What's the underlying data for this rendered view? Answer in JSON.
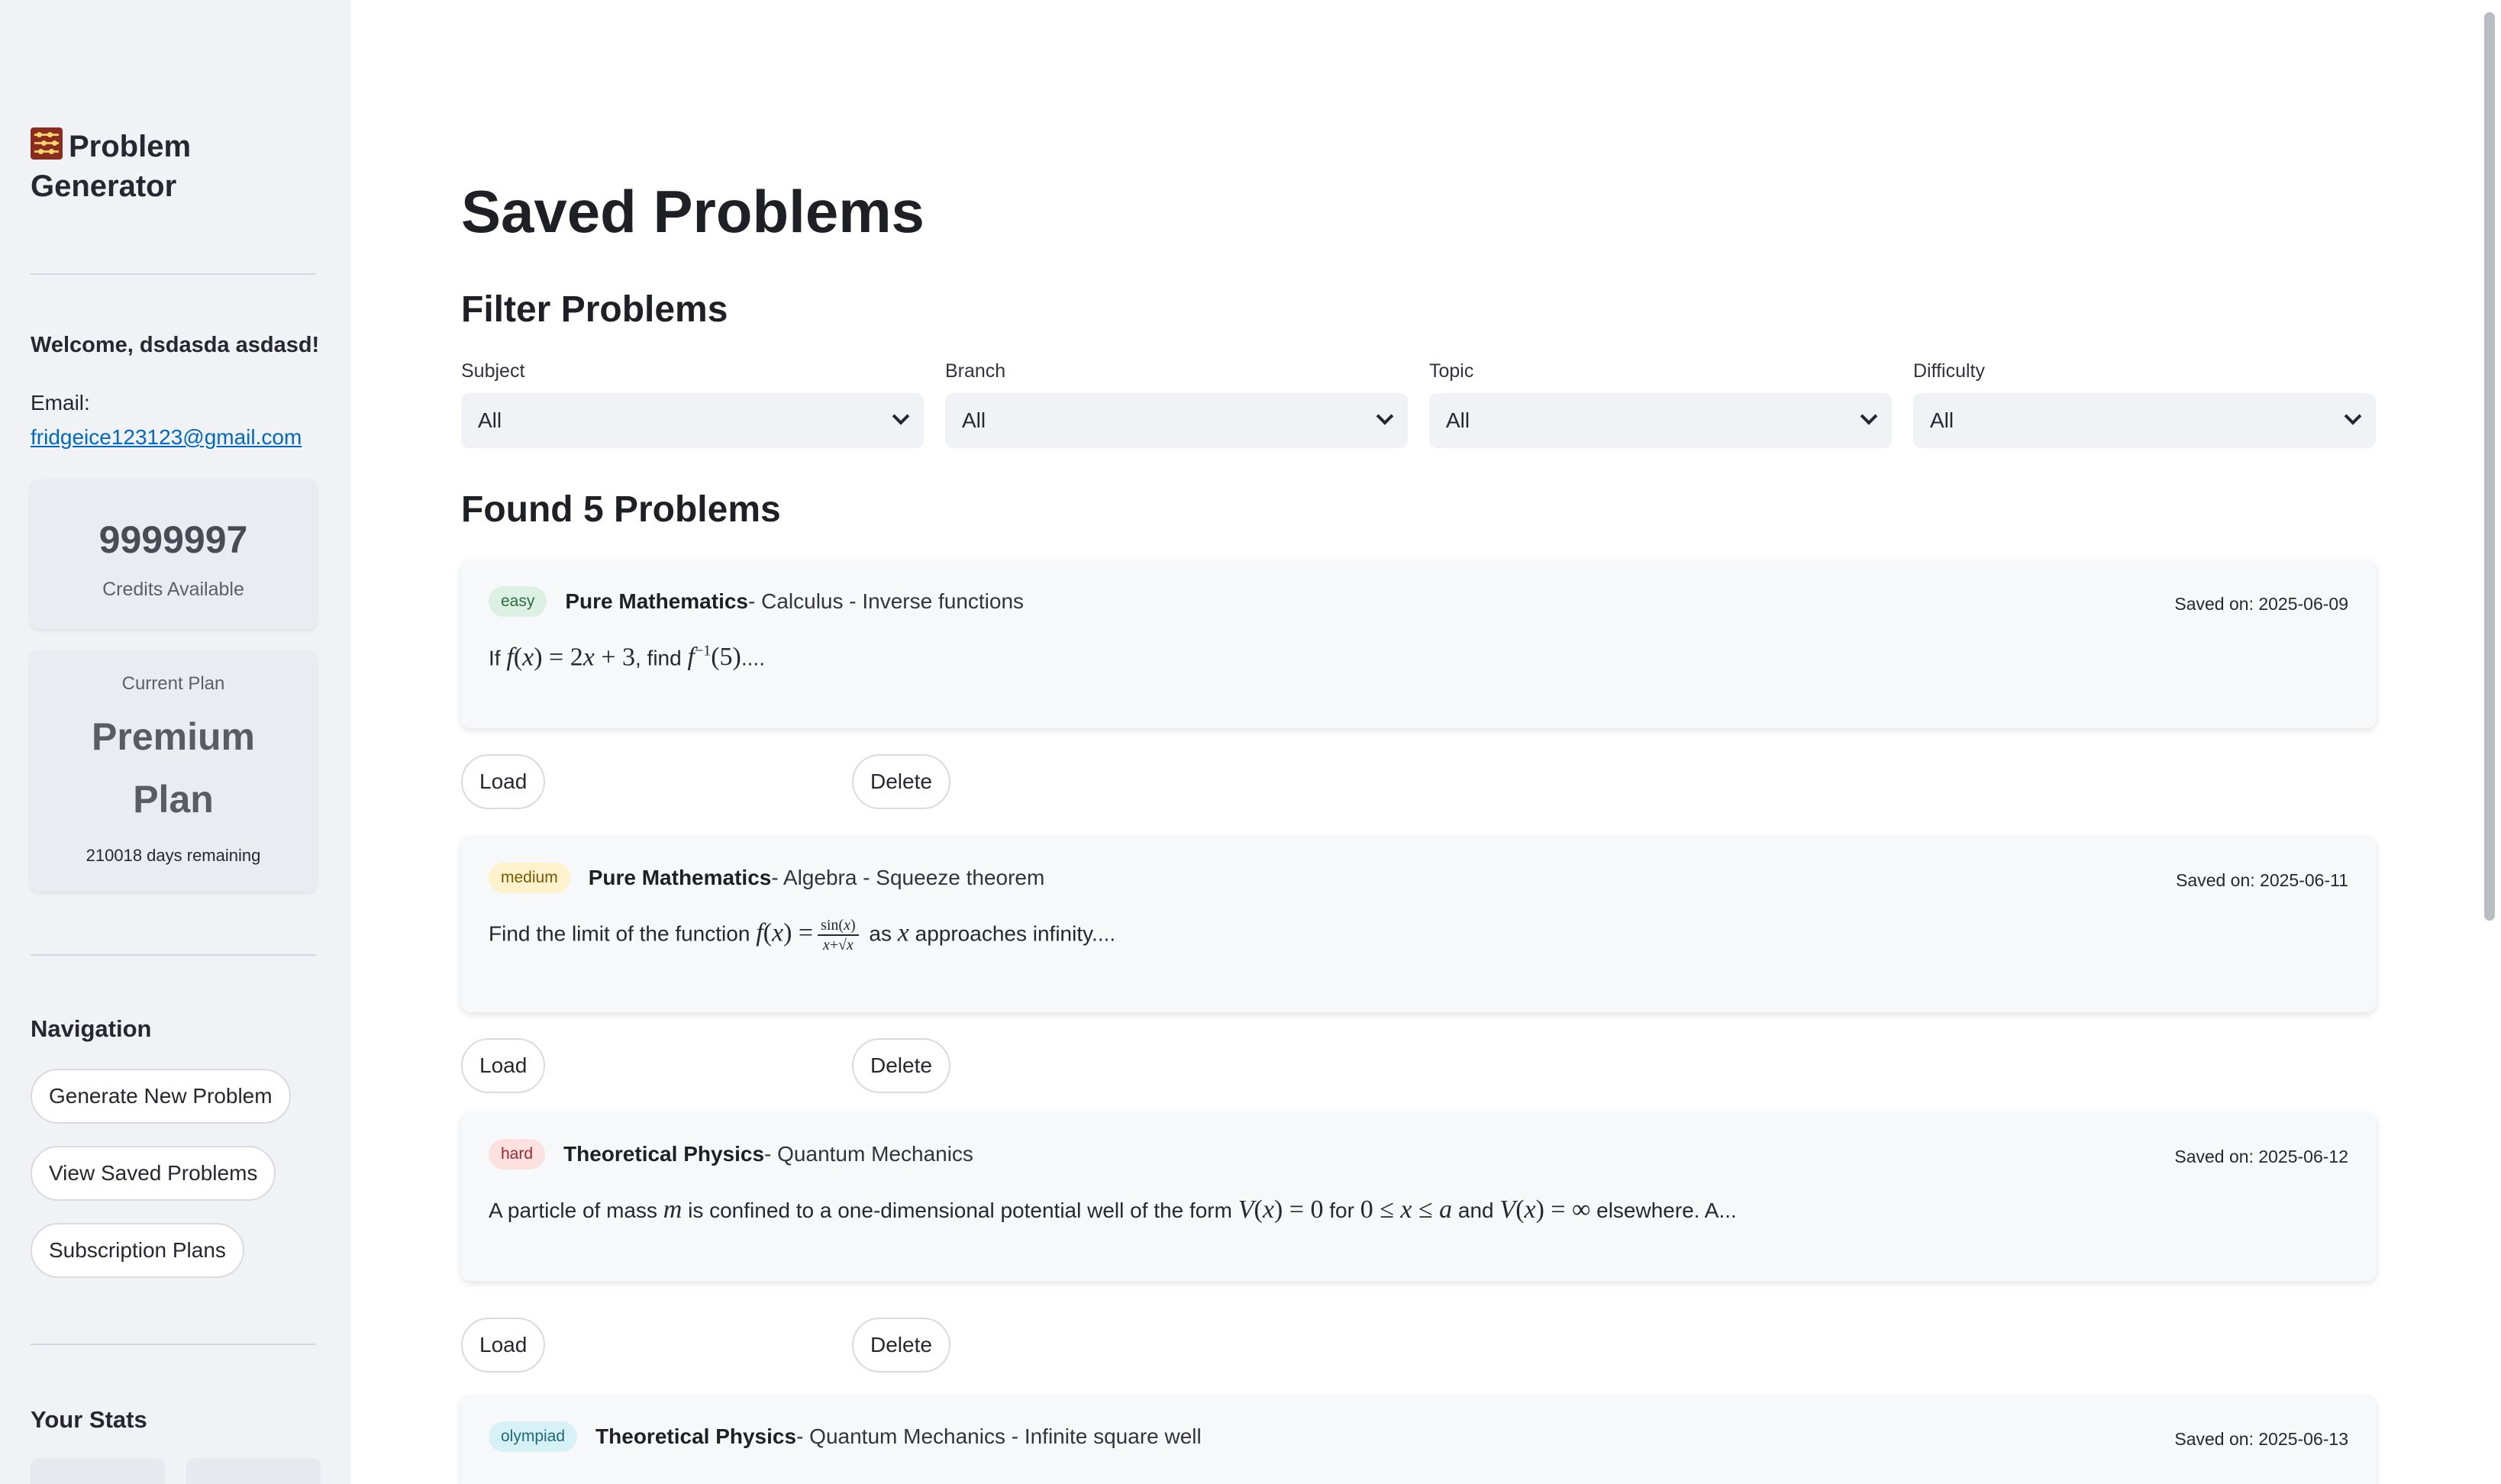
{
  "sidebar": {
    "brand_title": "Problem Generator",
    "welcome": "Welcome, dsdasda asdasd!",
    "email_label": "Email:",
    "email": "fridgeice123123@gmail.com",
    "credits_value": "9999997",
    "credits_label": "Credits Available",
    "plan_label": "Current Plan",
    "plan_name": "Premium Plan",
    "plan_days": "210018 days remaining",
    "nav_title": "Navigation",
    "nav_items": [
      "Generate New Problem",
      "View Saved Problems",
      "Subscription Plans"
    ],
    "stats_title": "Your Stats"
  },
  "main": {
    "page_title": "Saved Problems",
    "filter_title": "Filter Problems",
    "filters": [
      {
        "label": "Subject",
        "value": "All"
      },
      {
        "label": "Branch",
        "value": "All"
      },
      {
        "label": "Topic",
        "value": "All"
      },
      {
        "label": "Difficulty",
        "value": "All"
      }
    ],
    "found_title": "Found 5 Problems",
    "load_label": "Load",
    "delete_label": "Delete",
    "problems": [
      {
        "difficulty": "easy",
        "subject": "Pure Mathematics",
        "path": " - Calculus - Inverse functions",
        "saved": "Saved on: 2025-06-09",
        "text_a": "If ",
        "text_b": ", find ",
        "text_c": "...."
      },
      {
        "difficulty": "medium",
        "subject": "Pure Mathematics",
        "path": " - Algebra - Squeeze theorem",
        "saved": "Saved on: 2025-06-11",
        "text_a": "Find the limit of the function ",
        "text_b": " as ",
        "text_c": " approaches infinity...."
      },
      {
        "difficulty": "hard",
        "subject": "Theoretical Physics",
        "path": " - Quantum Mechanics",
        "saved": "Saved on: 2025-06-12",
        "text_a": "A particle of mass ",
        "text_b": " is confined to a one-dimensional potential well of the form ",
        "text_c": " for ",
        "text_d": " and ",
        "text_e": " elsewhere. A..."
      },
      {
        "difficulty": "olympiad",
        "subject": "Theoretical Physics",
        "path": " - Quantum Mechanics - Infinite square well",
        "saved": "Saved on: 2025-06-13"
      }
    ]
  },
  "colors": {
    "sidebar_bg": "#f0f2f6",
    "link": "#0068c9",
    "easy_badge": "#dcf0e3",
    "medium_badge": "#fdf2cc",
    "hard_badge": "#fde0e0",
    "olympiad_badge": "#d7f2f7"
  },
  "icons": {
    "brand": "abacus-icon",
    "select": "chevron-down-icon"
  }
}
